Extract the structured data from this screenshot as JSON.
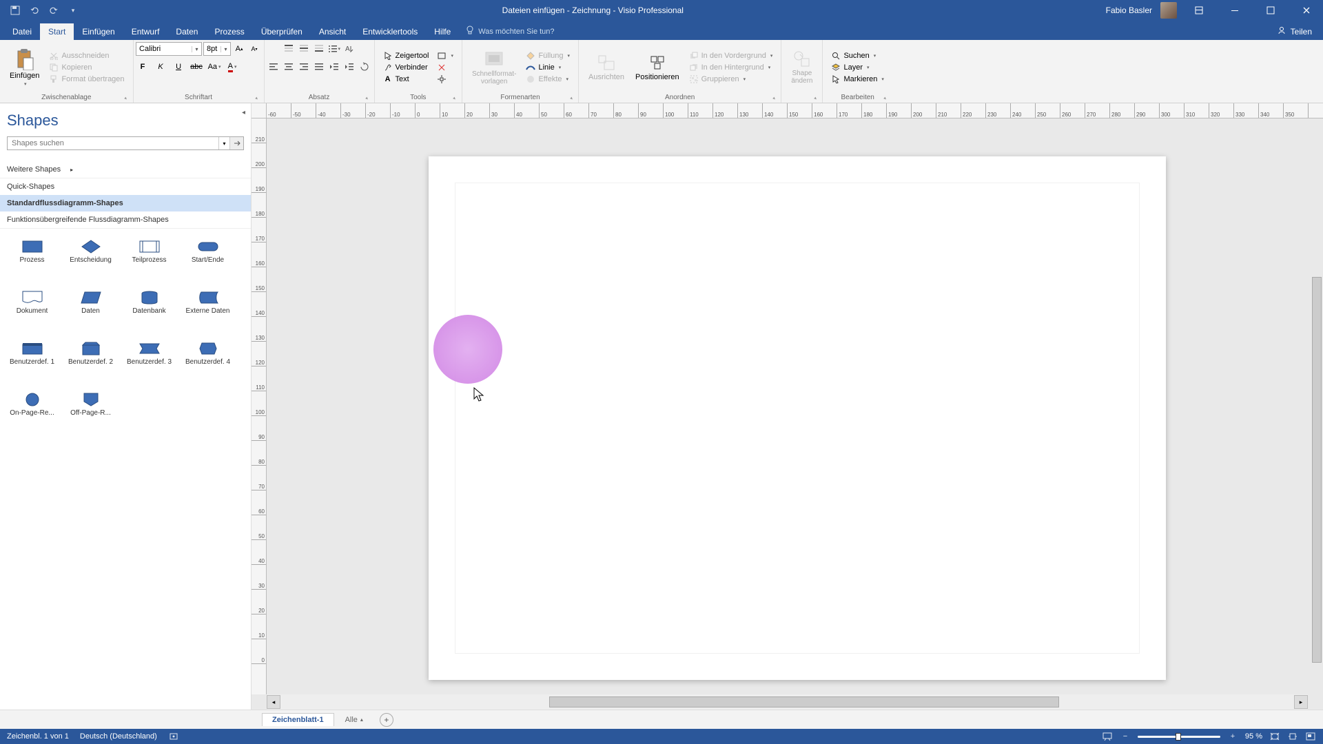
{
  "titlebar": {
    "title": "Dateien einfügen - Zeichnung  -  Visio Professional",
    "user": "Fabio Basler"
  },
  "menu": {
    "tabs": [
      "Datei",
      "Start",
      "Einfügen",
      "Entwurf",
      "Daten",
      "Prozess",
      "Überprüfen",
      "Ansicht",
      "Entwicklertools",
      "Hilfe"
    ],
    "active": 1,
    "tellme": "Was möchten Sie tun?",
    "share": "Teilen"
  },
  "ribbon": {
    "clipboard": {
      "label": "Zwischenablage",
      "paste": "Einfügen",
      "cut": "Ausschneiden",
      "copy": "Kopieren",
      "format": "Format übertragen"
    },
    "font": {
      "label": "Schriftart",
      "family": "Calibri",
      "size": "8pt."
    },
    "para": {
      "label": "Absatz"
    },
    "tools": {
      "label": "Tools",
      "pointer": "Zeigertool",
      "connector": "Verbinder",
      "text": "Text"
    },
    "styles": {
      "label": "Formenarten",
      "quickstyles": "Schnellformat-\nvorlagen",
      "fill": "Füllung",
      "line": "Linie",
      "effects": "Effekte"
    },
    "arrange": {
      "label": "Anordnen",
      "align": "Ausrichten",
      "position": "Positionieren",
      "tofront": "In den Vordergrund",
      "toback": "In den Hintergrund",
      "group": "Gruppieren"
    },
    "shape": {
      "label": "",
      "btn": "Shape\nändern"
    },
    "edit": {
      "label": "Bearbeiten",
      "find": "Suchen",
      "layer": "Layer",
      "select": "Markieren"
    }
  },
  "sidebar": {
    "title": "Shapes",
    "search": "Shapes suchen",
    "more_shapes": "Weitere Shapes",
    "cats": [
      "Quick-Shapes",
      "Standardflussdiagramm-Shapes",
      "Funktionsübergreifende Flussdiagramm-Shapes"
    ],
    "cat_sel": 1,
    "shapes": [
      "Prozess",
      "Entscheidung",
      "Teilprozess",
      "Start/Ende",
      "Dokument",
      "Daten",
      "Datenbank",
      "Externe Daten",
      "Benutzerdef. 1",
      "Benutzerdef. 2",
      "Benutzerdef. 3",
      "Benutzerdef. 4",
      "On-Page-Re...",
      "Off-Page-R..."
    ]
  },
  "ruler_h": [
    "-60",
    "-50",
    "-40",
    "-30",
    "-20",
    "-10",
    "0",
    "10",
    "20",
    "30",
    "40",
    "50",
    "60",
    "70",
    "80",
    "90",
    "100",
    "110",
    "120",
    "130",
    "140",
    "150",
    "160",
    "170",
    "180",
    "190",
    "200",
    "210",
    "220",
    "230",
    "240",
    "250",
    "260",
    "270",
    "280",
    "290",
    "300",
    "310",
    "320",
    "330",
    "340",
    "350"
  ],
  "ruler_v": [
    "210",
    "200",
    "190",
    "180",
    "170",
    "160",
    "150",
    "140",
    "130",
    "120",
    "110",
    "100",
    "90",
    "80",
    "70",
    "60",
    "50",
    "40",
    "30",
    "20",
    "10",
    "0"
  ],
  "tabs": {
    "page": "Zeichenblatt-1",
    "all": "Alle"
  },
  "status": {
    "page": "Zeichenbl. 1 von 1",
    "lang": "Deutsch (Deutschland)",
    "zoom": "95 %"
  }
}
